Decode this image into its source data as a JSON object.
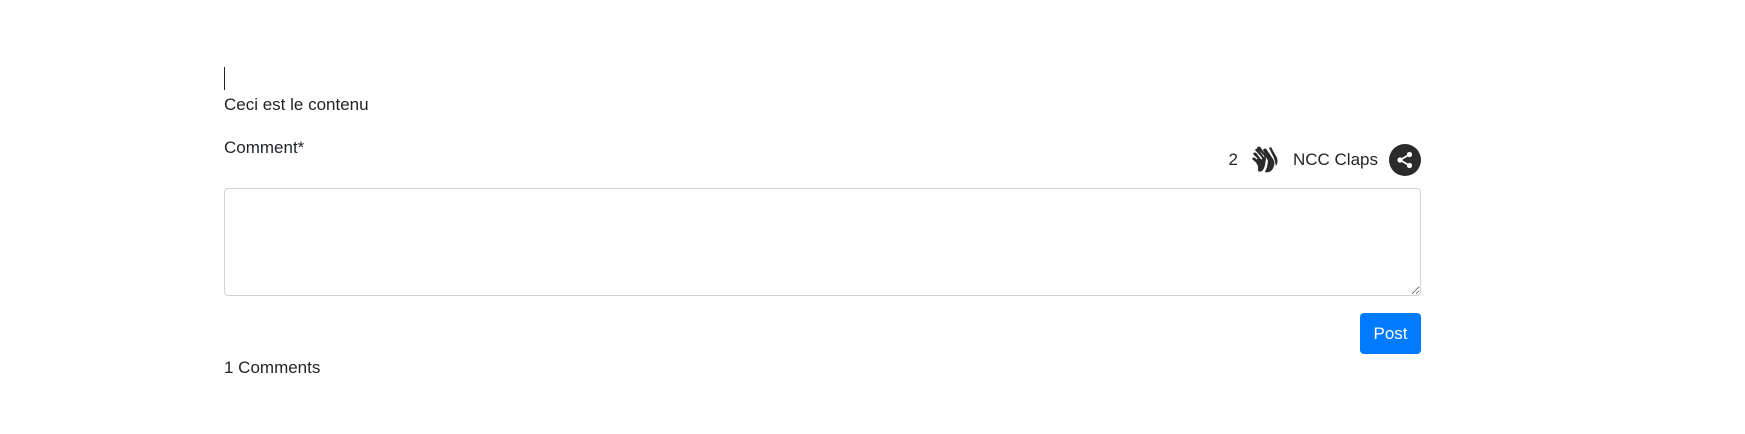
{
  "content": {
    "text": "Ceci est le contenu"
  },
  "comment_form": {
    "label": "Comment*",
    "textarea_value": "",
    "post_label": "Post"
  },
  "claps": {
    "count": "2",
    "label": "NCC Claps"
  },
  "comments": {
    "count_label": "1 Comments"
  },
  "icons": {
    "clap": "clapping-hands-icon",
    "share": "share-icon"
  },
  "colors": {
    "primary": "#007bff",
    "icon_dark": "#2b2b2b",
    "border": "#ced4da"
  }
}
